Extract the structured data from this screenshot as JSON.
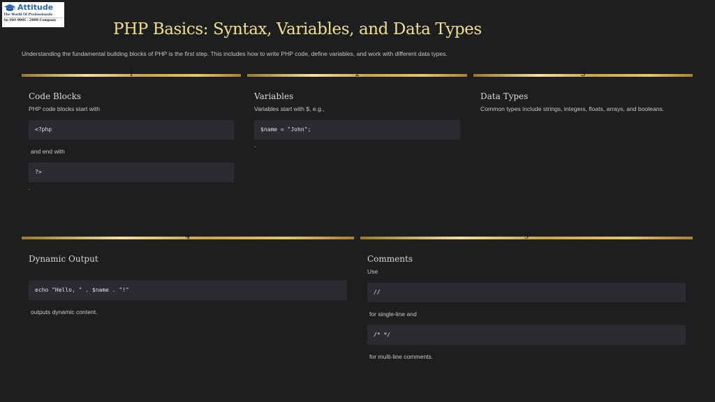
{
  "logo": {
    "name": "Attitude",
    "tagline": "The World Of Professionals",
    "iso": "An ISO 9001 : 2008 Company"
  },
  "title": "PHP Basics: Syntax, Variables, and Data Types",
  "subtitle": "Understanding the fundamental building blocks of PHP is the first step. This includes how to write PHP code, define variables, and work with different data types.",
  "sections": [
    {
      "number": "1",
      "heading": "Code Blocks",
      "text1": "PHP code blocks start with",
      "code1": "<?php",
      "text2": "and end with",
      "code2": "?>",
      "end": "."
    },
    {
      "number": "2",
      "heading": "Variables",
      "text1": "Variables start with $, e.g.,",
      "code1": "$name = \"John\";",
      "end": "."
    },
    {
      "number": "3",
      "heading": "Data Types",
      "text1": "Common types include strings, integers, floats, arrays, and booleans."
    },
    {
      "number": "4",
      "heading": "Dynamic Output",
      "code1": "echo \"Hello, \" . $name . \"!\"",
      "text2": "outputs dynamic content."
    },
    {
      "number": "5",
      "heading": "Comments",
      "text1": "Use",
      "code1": "//",
      "text2": "for single-line and",
      "code2": "/* */",
      "text3": "for multi-line comments."
    }
  ],
  "colors": {
    "background": "#1d1e20",
    "title": "#efe08a",
    "code_background": "#2b2c2f",
    "gold": "#d8b65a"
  }
}
